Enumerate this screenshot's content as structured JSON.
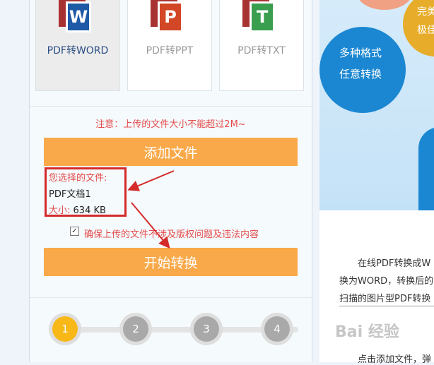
{
  "cards": [
    {
      "label": "PDF转WORD",
      "letter": "W",
      "color": "#1e5aa6"
    },
    {
      "label": "PDF转PPT",
      "letter": "P",
      "color": "#d24726"
    },
    {
      "label": "PDF转TXT",
      "letter": "T",
      "color": "#3a9e4f"
    }
  ],
  "notice": "注意：上传的文件大小不能超过2M~",
  "add_file_button": "添加文件",
  "file_info": {
    "selected_label": "您选择的文件:",
    "file_name": "PDF文档1",
    "size_label": "大小:",
    "size_value": "634 KB"
  },
  "agreement": {
    "checked": true,
    "text": "确保上传的文件不涉及版权问题及违法内容"
  },
  "start_button": "开始转换",
  "steps": [
    "1",
    "2",
    "3",
    "4"
  ],
  "right": {
    "bubble_text_1": "多种格式",
    "bubble_text_2": "任意转换",
    "corner_text_1": "完美",
    "corner_text_2": "极佳",
    "desc_line_1": "在线PDF转换成W",
    "desc_line_2": "换为WORD，转换后的",
    "desc_line_3": "扫描的图片型PDF转换",
    "desc_line_4": "点击添加文件，弹"
  },
  "watermark": "Bai 经验"
}
